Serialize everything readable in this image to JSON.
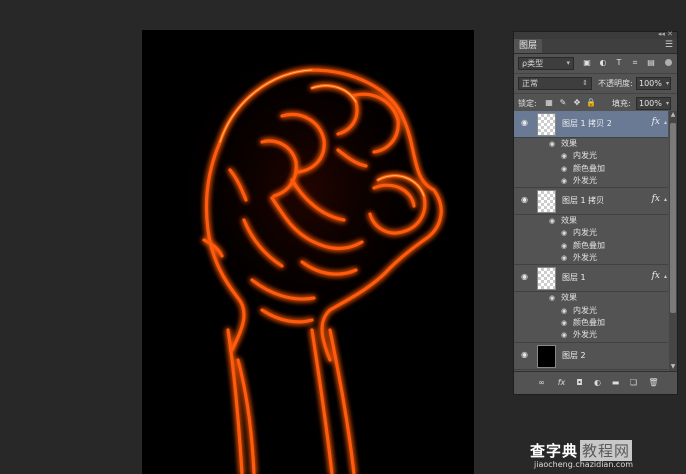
{
  "panel": {
    "tab_label": "图层",
    "collapse_glyph": "◂◂ ✕",
    "menu_glyph": "☰",
    "filter": {
      "value": "ρ类型"
    },
    "blend_mode": {
      "value": "正常"
    },
    "opacity": {
      "label": "不透明度:",
      "value": "100%"
    },
    "lock": {
      "label": "锁定:"
    },
    "fill": {
      "label": "填充:",
      "value": "100%"
    }
  },
  "layers": [
    {
      "name": "图层 1 拷贝 2",
      "active": true,
      "thumb": "transparent",
      "fx": "fx",
      "effects_label": "效果",
      "effects": [
        "内发光",
        "颜色叠加",
        "外发光"
      ]
    },
    {
      "name": "图层 1 拷贝",
      "active": false,
      "thumb": "transparent",
      "fx": "fx",
      "effects_label": "效果",
      "effects": [
        "内发光",
        "颜色叠加",
        "外发光"
      ]
    },
    {
      "name": "图层 1",
      "active": false,
      "thumb": "transparent",
      "fx": "fx",
      "effects_label": "效果",
      "effects": [
        "内发光",
        "颜色叠加",
        "外发光"
      ]
    },
    {
      "name": "图层 2",
      "active": false,
      "thumb": "black",
      "fx": ""
    }
  ],
  "footer_icons": [
    "link-icon",
    "fx-icon",
    "mask-icon",
    "adjustment-icon",
    "folder-icon",
    "new-layer-icon",
    "trash-icon"
  ],
  "watermark": {
    "brand": "查字典",
    "site": "教程网",
    "url": "jiaocheng.chazidian.com"
  },
  "colors": {
    "glow_outer": "#ff3a00",
    "glow_inner": "#ffb030",
    "selection": "#6a7a94"
  }
}
